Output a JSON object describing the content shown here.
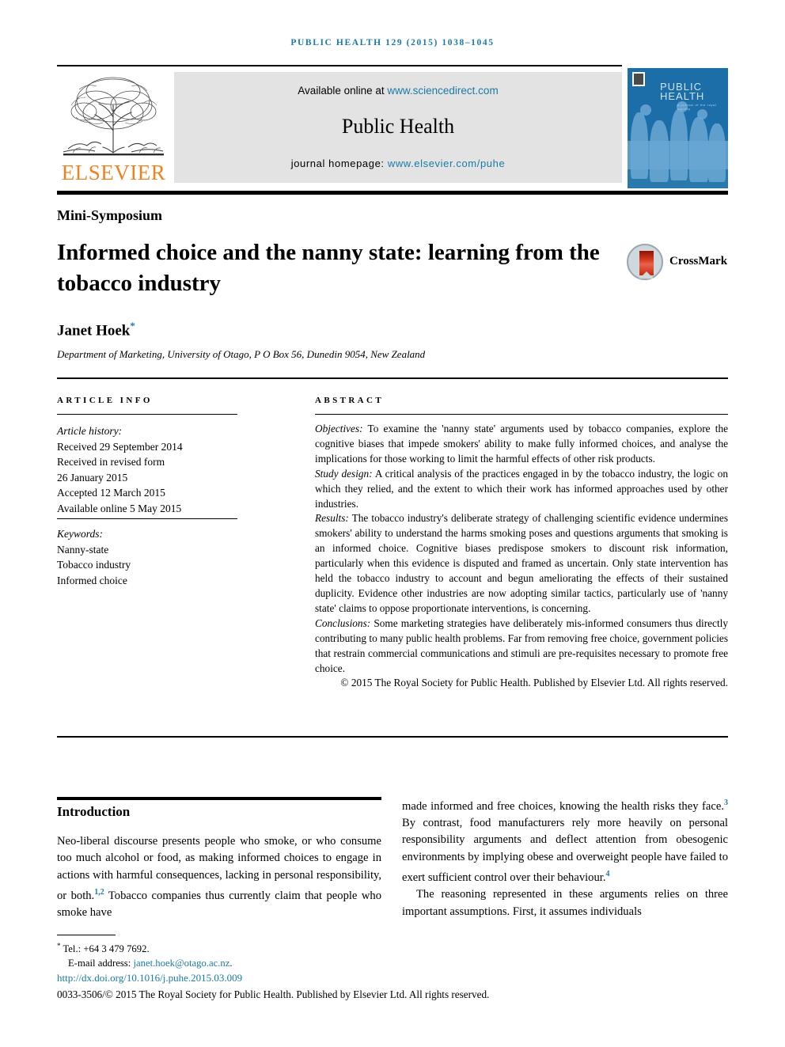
{
  "running_head": "PUBLIC HEALTH 129 (2015) 1038–1045",
  "header": {
    "publisher_logo_text": "ELSEVIER",
    "available_prefix": "Available online at ",
    "available_link": "www.sciencedirect.com",
    "journal_name": "Public Health",
    "homepage_prefix": "journal homepage: ",
    "homepage_link": "www.elsevier.com/puhe",
    "cover_title_line1": "PUBLIC",
    "cover_title_line2": "HEALTH",
    "cover_subtitle": "a journal of the royal society"
  },
  "article": {
    "section_label": "Mini-Symposium",
    "title": "Informed choice and the nanny state: learning from the tobacco industry",
    "crossmark_label": "CrossMark",
    "author": "Janet Hoek",
    "author_marker": "*",
    "affiliation": "Department of Marketing, University of Otago, P O Box 56, Dunedin 9054, New Zealand"
  },
  "article_info": {
    "heading": "ARTICLE INFO",
    "history_label": "Article history:",
    "history": [
      "Received 29 September 2014",
      "Received in revised form",
      "26 January 2015",
      "Accepted 12 March 2015",
      "Available online 5 May 2015"
    ],
    "keywords_label": "Keywords:",
    "keywords": [
      "Nanny-state",
      "Tobacco industry",
      "Informed choice"
    ]
  },
  "abstract": {
    "heading": "ABSTRACT",
    "objectives_label": "Objectives:",
    "objectives_text": " To examine the 'nanny state' arguments used by tobacco companies, explore the cognitive biases that impede smokers' ability to make fully informed choices, and analyse the implications for those working to limit the harmful effects of other risk products.",
    "study_design_label": "Study design:",
    "study_design_text": " A critical analysis of the practices engaged in by the tobacco industry, the logic on which they relied, and the extent to which their work has informed approaches used by other industries.",
    "results_label": "Results:",
    "results_text": " The tobacco industry's deliberate strategy of challenging scientific evidence undermines smokers' ability to understand the harms smoking poses and questions arguments that smoking is an informed choice. Cognitive biases predispose smokers to discount risk information, particularly when this evidence is disputed and framed as uncertain. Only state intervention has held the tobacco industry to account and begun ameliorating the effects of their sustained duplicity. Evidence other industries are now adopting similar tactics, particularly use of 'nanny state' claims to oppose proportionate interventions, is concerning.",
    "conclusions_label": "Conclusions:",
    "conclusions_text": " Some marketing strategies have deliberately mis-informed consumers thus directly contributing to many public health problems. Far from removing free choice, government policies that restrain commercial communications and stimuli are pre-requisites necessary to promote free choice.",
    "copyright": "© 2015 The Royal Society for Public Health. Published by Elsevier Ltd. All rights reserved."
  },
  "body": {
    "intro_heading": "Introduction",
    "left_paragraph_1_a": "Neo-liberal discourse presents people who smoke, or who consume too much alcohol or food, as making informed choices to engage in actions with harmful consequences, lacking in personal responsibility, or both.",
    "left_ref_1": "1,2",
    "left_paragraph_1_b": " Tobacco companies thus currently claim that people who smoke have",
    "right_paragraph_1_a": "made informed and free choices, knowing the health risks they face.",
    "right_ref_1": "3",
    "right_paragraph_1_b": " By contrast, food manufacturers rely more heavily on personal responsibility arguments and deflect attention from obesogenic environments by implying obese and overweight people have failed to exert sufficient control over their behaviour.",
    "right_ref_2": "4",
    "right_paragraph_2": "The reasoning represented in these arguments relies on three important assumptions. First, it assumes individuals"
  },
  "footer": {
    "footnote_marker": "*",
    "tel_label": " Tel.: +64 3 479 7692.",
    "email_label": "E-mail address: ",
    "email_value": "janet.hoek@otago.ac.nz",
    "email_period": ".",
    "doi": "http://dx.doi.org/10.1016/j.puhe.2015.03.009",
    "issn_line": "0033-3506/© 2015 The Royal Society for Public Health. Published by Elsevier Ltd. All rights reserved."
  },
  "colors": {
    "link": "#1a7aa8",
    "elsevier_orange": "#f0821e",
    "cover_blue": "#1b6ea8"
  }
}
